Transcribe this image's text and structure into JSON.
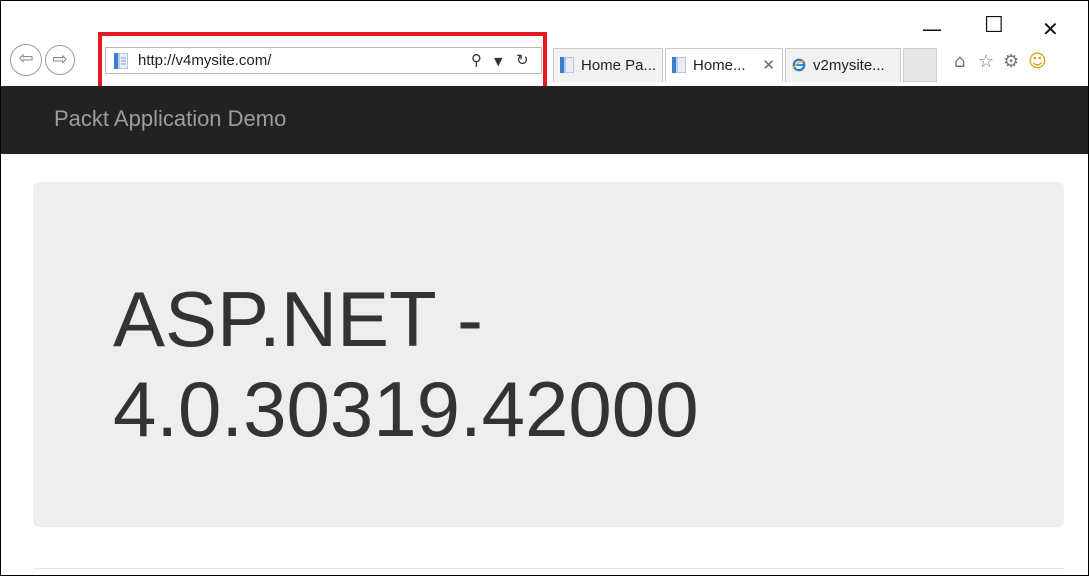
{
  "browser": {
    "address_url": "http://v4mysite.com/",
    "tabs": [
      {
        "label": "Home Pa...",
        "active": false
      },
      {
        "label": "Home...",
        "active": true
      },
      {
        "label": "v2mysite...",
        "active": false
      }
    ],
    "highlight_color": "#e21b23"
  },
  "navbar": {
    "brand": "Packt Application Demo",
    "background": "#222222"
  },
  "jumbotron": {
    "heading_line1": "ASP.NET -",
    "heading_line2": "4.0.30319.42000"
  }
}
